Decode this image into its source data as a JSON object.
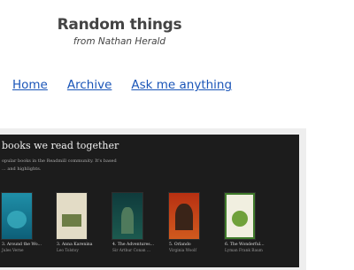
{
  "header": {
    "title": "Random things",
    "subtitle": "from Nathan Herald"
  },
  "nav": {
    "items": [
      {
        "label": "Home"
      },
      {
        "label": "Archive"
      },
      {
        "label": "Ask me anything"
      }
    ]
  },
  "widget": {
    "title": "books we read together",
    "description": "opular books in the Readmill community. It's based ... and highlights.",
    "books": [
      {
        "title": "3. Around the Wo...",
        "author": "Jules Verne",
        "cover_color": "#1f8fa8"
      },
      {
        "title": "3. Anna Karenina",
        "author": "Leo Tolstoy",
        "cover_color": "#e3dcc6"
      },
      {
        "title": "4. The Adventures...",
        "author": "Sir Arthur Conan ...",
        "cover_color": "#0f3b3c"
      },
      {
        "title": "5. Orlando",
        "author": "Virginia Woolf",
        "cover_color": "#b73012"
      },
      {
        "title": "6. The Wonderful...",
        "author": "Lyman Frank Baum",
        "cover_color": "#f1efe0"
      }
    ]
  }
}
